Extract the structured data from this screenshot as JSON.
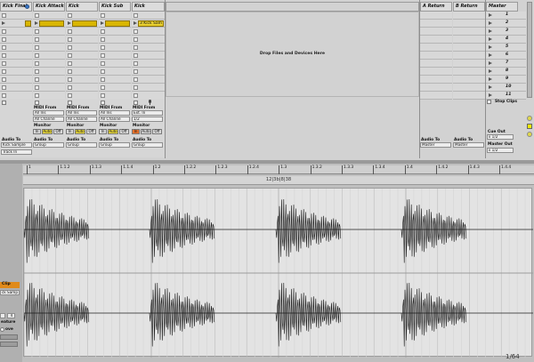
{
  "tracks": [
    {
      "name": "Kick Final",
      "clip": ""
    },
    {
      "name": "Kick Attack",
      "clip": ""
    },
    {
      "name": "Kick Midlow",
      "clip": ""
    },
    {
      "name": "Kick Sub",
      "clip": ""
    },
    {
      "name": "Kick Sample",
      "clip": "3 Kick Sam"
    }
  ],
  "returns": [
    {
      "name": "A Return"
    },
    {
      "name": "B Return"
    }
  ],
  "master": {
    "name": "Master",
    "scenes": [
      "1",
      "2",
      "3",
      "4",
      "5",
      "6",
      "7",
      "8",
      "9",
      "10",
      "11"
    ],
    "stop_clips": "Stop Clips"
  },
  "dropzone": "Drop Files and Devices Here",
  "io": {
    "midi_from": "MIDI From",
    "all_ins": "All Ins",
    "all_channels": "All Channe",
    "ext_in": "Ext. In",
    "ext_sub": "1/2",
    "monitor": "Monitor",
    "in": "In",
    "auto": "Auto",
    "off": "Off",
    "audio_to": "Audio To",
    "kick_sample": "Kick Sample",
    "group": "Group",
    "track_in": "Track In",
    "master": "Master",
    "cue_out": "Cue Out",
    "cue_val": "ii 1/2",
    "master_out": "Master Out",
    "master_val": "ii 1/2"
  },
  "ruler": {
    "ticks": [
      "1",
      "1.1.2",
      "1.1.3",
      "1.1.4",
      "1.2",
      "1.2.2",
      "1.2.3",
      "1.2.4",
      "1.3",
      "1.3.2",
      "1.3.3",
      "1.3.4",
      "1.4",
      "1.4.2",
      "1.4.3",
      "1.4.4"
    ]
  },
  "loop_label": "12|3b|8|38",
  "zoom": "1/64",
  "clip_panel": {
    "title": "Clip",
    "name": "ck Samp",
    "signature": "4",
    "field": "eature",
    "warp": "ove",
    "btn1": "",
    "btn2": ""
  }
}
